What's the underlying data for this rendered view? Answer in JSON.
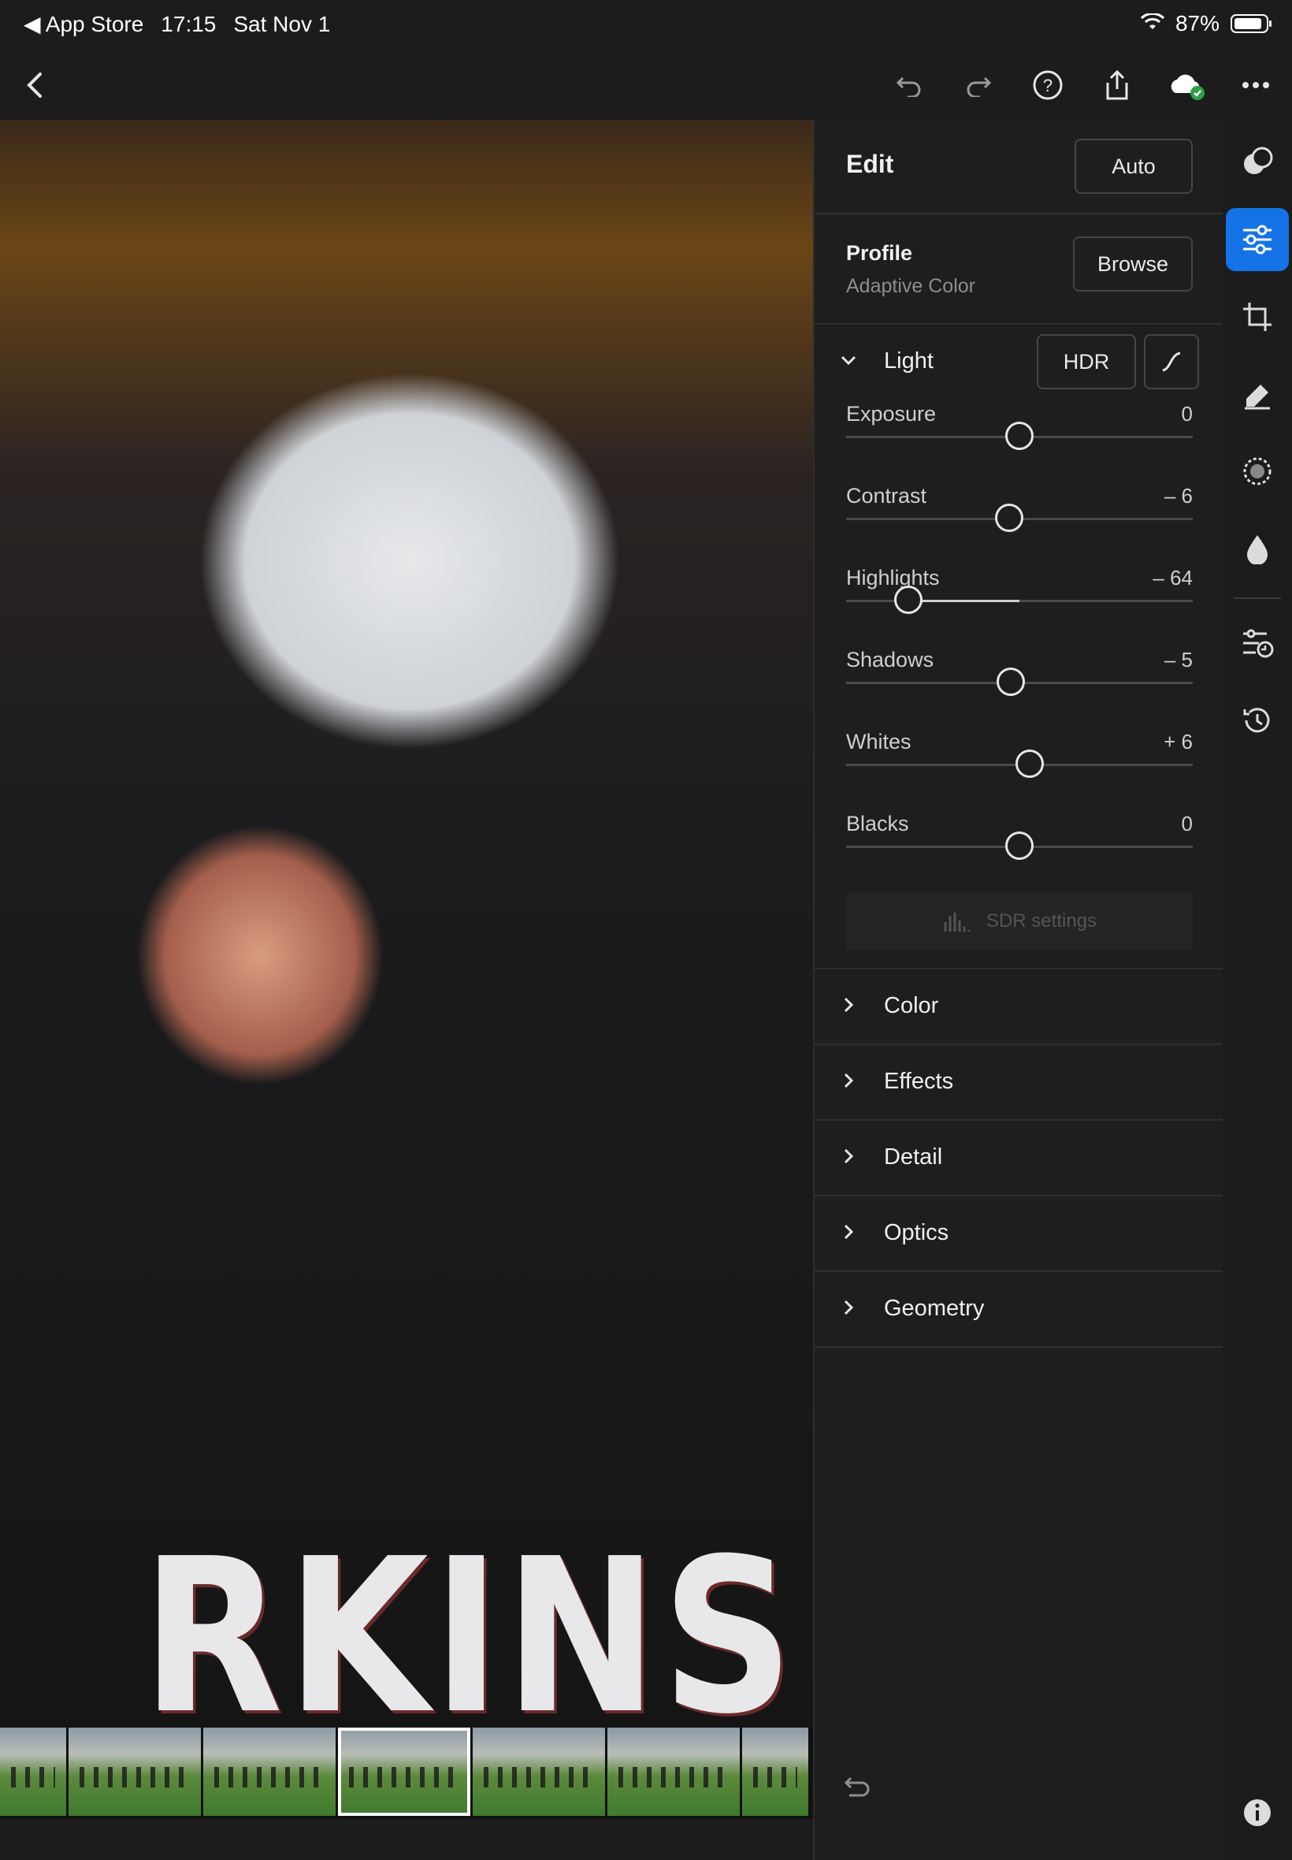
{
  "status_bar": {
    "back_app": "◀ App Store",
    "time": "17:15",
    "date": "Sat Nov 1",
    "battery": "87%"
  },
  "toolbar": {
    "icons": [
      "back-chevron-icon",
      "undo-icon",
      "redo-icon",
      "help-icon",
      "share-icon",
      "cloud-sync-icon",
      "more-icon"
    ]
  },
  "photo": {
    "jersey_text": "RKINS"
  },
  "filmstrip": {
    "count": 6,
    "selected_index": 2
  },
  "panel": {
    "title": "Edit",
    "auto_label": "Auto",
    "profile": {
      "label": "Profile",
      "value": "Adaptive Color",
      "browse_label": "Browse"
    },
    "light": {
      "label": "Light",
      "hdr_label": "HDR",
      "sliders": [
        {
          "name": "Exposure",
          "value": "0",
          "level": 0
        },
        {
          "name": "Contrast",
          "value": "– 6",
          "level": -6
        },
        {
          "name": "Highlights",
          "value": "– 64",
          "level": -64
        },
        {
          "name": "Shadows",
          "value": "– 5",
          "level": -5
        },
        {
          "name": "Whites",
          "value": "+ 6",
          "level": 6
        },
        {
          "name": "Blacks",
          "value": "0",
          "level": 0
        }
      ],
      "sdr_label": "SDR settings"
    },
    "sections": [
      "Color",
      "Effects",
      "Detail",
      "Optics",
      "Geometry"
    ]
  },
  "rail": {
    "icons": [
      "masking-icon",
      "edit-sliders-icon",
      "crop-icon",
      "healing-icon",
      "selective-icon",
      "color-drop-icon",
      "presets-icon",
      "history-icon",
      "info-icon"
    ],
    "active": "edit-sliders-icon"
  },
  "colors": {
    "accent": "#1473e6",
    "panel_bg": "#1e1e1e",
    "cloud_check": "#2ea043"
  }
}
